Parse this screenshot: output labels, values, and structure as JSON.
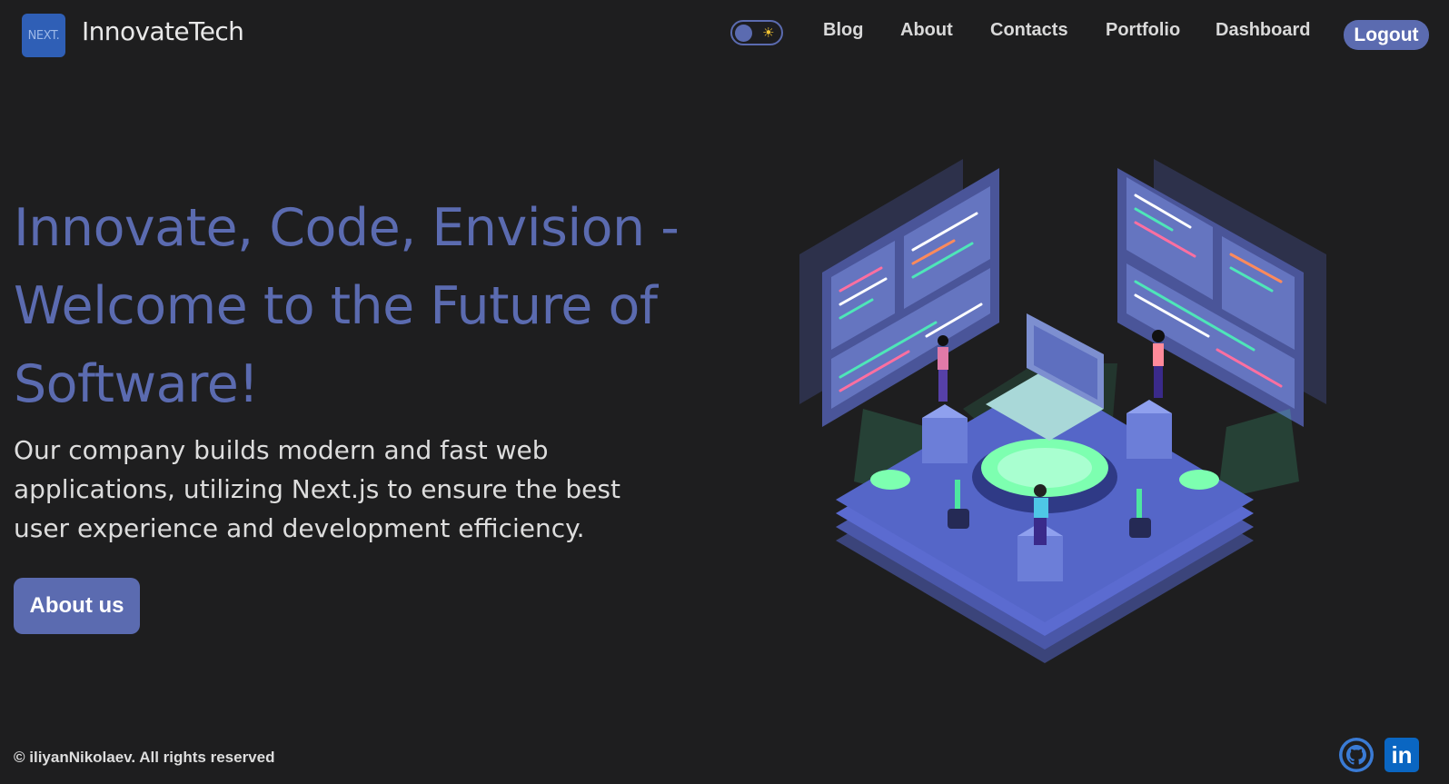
{
  "header": {
    "logo_text": "NEXT.",
    "brand": "InnovateTech",
    "theme_toggle": {
      "icon": "sun-icon",
      "state": "dark"
    },
    "nav": [
      {
        "label": "Blog"
      },
      {
        "label": "About"
      },
      {
        "label": "Contacts"
      },
      {
        "label": "Portfolio"
      },
      {
        "label": "Dashboard"
      }
    ],
    "logout_label": "Logout"
  },
  "hero": {
    "title": "Innovate, Code, Envision - Welcome to the Future of Software!",
    "description": "Our company builds modern and fast web applications, utilizing Next.js to ensure the best user experience and development efficiency.",
    "cta_label": "About us",
    "illustration": "isometric-developers-platform-illustration"
  },
  "footer": {
    "copyright": "© iliyanNikolaev. All rights reserved",
    "social": [
      {
        "name": "github-icon"
      },
      {
        "name": "linkedin-icon",
        "text": "in"
      }
    ]
  },
  "colors": {
    "background": "#1e1e1f",
    "accent": "#5b6bb0",
    "text": "#dddddd",
    "linkedin": "#0a66c2"
  }
}
